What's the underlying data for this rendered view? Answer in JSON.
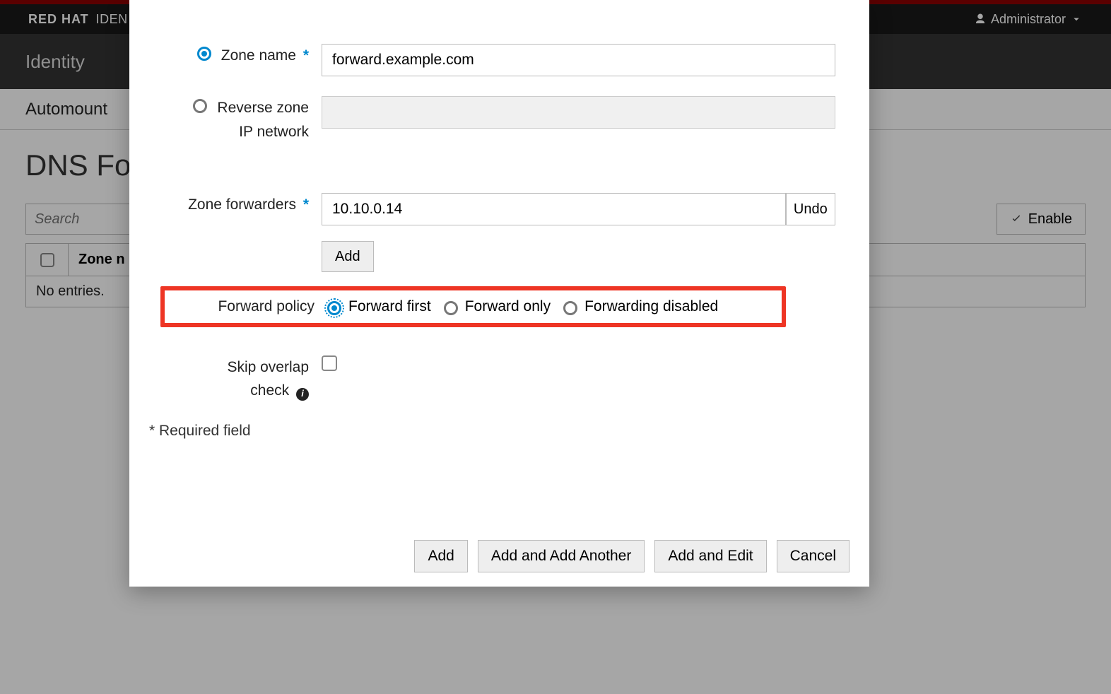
{
  "brand": {
    "company": "RED HAT",
    "product_suffix": "IDEN",
    "user_label": "Administrator"
  },
  "nav": {
    "primary_item": "Identity",
    "secondary_item": "Automount"
  },
  "page": {
    "title_visible": "DNS Fo"
  },
  "search": {
    "placeholder": "Search"
  },
  "buttons": {
    "enable": "Enable"
  },
  "table": {
    "col_zone_truncated": "Zone n",
    "empty_text": "No entries."
  },
  "modal": {
    "zone_name": {
      "label": "Zone name",
      "value": "forward.example.com"
    },
    "reverse_zone": {
      "label1": "Reverse zone",
      "label2": "IP network"
    },
    "zone_forwarders": {
      "label": "Zone forwarders",
      "value": "10.10.0.14",
      "undo": "Undo",
      "add": "Add"
    },
    "forward_policy": {
      "label": "Forward policy",
      "opt_first": "Forward first",
      "opt_only": "Forward only",
      "opt_disabled": "Forwarding disabled"
    },
    "skip_overlap": {
      "label1": "Skip overlap",
      "label2": "check"
    },
    "required_note": "* Required field",
    "footer": {
      "add": "Add",
      "add_another": "Add and Add Another",
      "add_edit": "Add and Edit",
      "cancel": "Cancel"
    }
  }
}
